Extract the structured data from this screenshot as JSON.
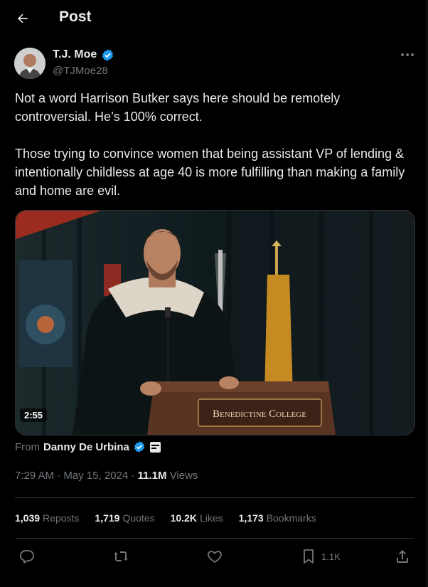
{
  "header": {
    "title": "Post"
  },
  "author": {
    "name": "T.J. Moe",
    "handle": "@TJMoe28"
  },
  "tweet": {
    "text": "Not a word Harrison Butker says here should be remotely controversial. He’s 100% correct.\n\nThose trying to convince women that being assistant VP of lending & intentionally childless at age 40 is more fulfilling than making a family and home are evil."
  },
  "media": {
    "duration": "2:55",
    "podium_text": "Benedictine College"
  },
  "from": {
    "label": "From",
    "name": "Danny De Urbina"
  },
  "meta": {
    "time": "7:29 AM",
    "date": "May 15, 2024",
    "views_count": "11.1M",
    "views_label": "Views"
  },
  "stats": {
    "reposts": {
      "count": "1,039",
      "label": "Reposts"
    },
    "quotes": {
      "count": "1,719",
      "label": "Quotes"
    },
    "likes": {
      "count": "10.2K",
      "label": "Likes"
    },
    "bookmarks": {
      "count": "1,173",
      "label": "Bookmarks"
    }
  },
  "actions": {
    "bookmark_count": "1.1K"
  },
  "colors": {
    "background": "#000000",
    "text": "#e7e9ea",
    "muted": "#71767b",
    "divider": "#2f3336",
    "verified": "#1d9bf0"
  }
}
